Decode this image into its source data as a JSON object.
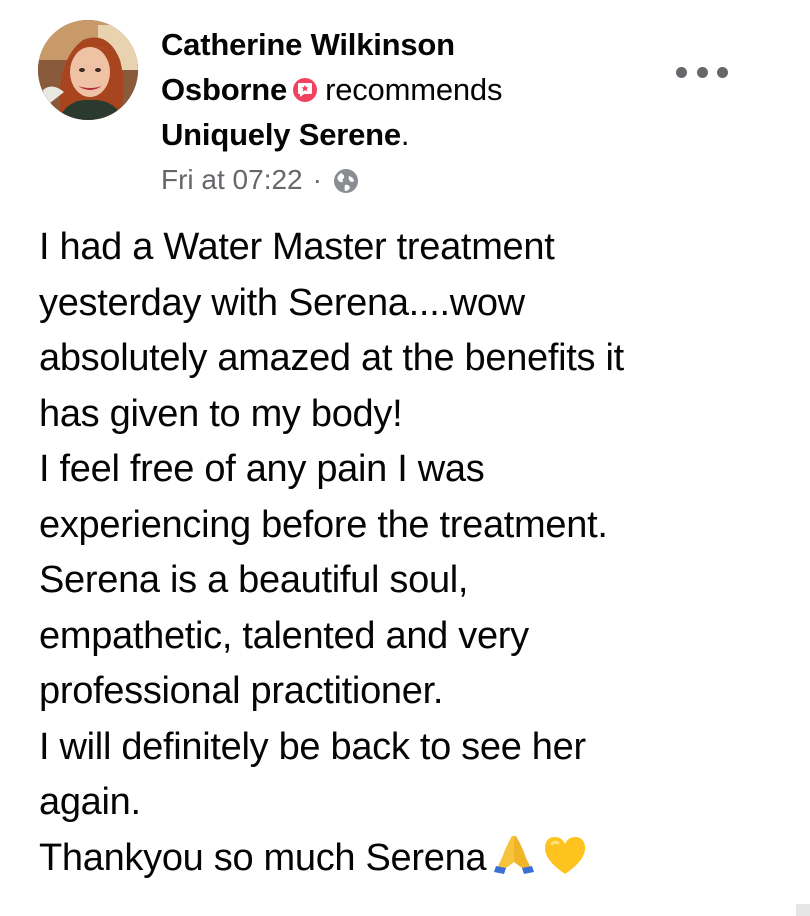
{
  "post": {
    "author": {
      "name_line1": "Catherine Wilkinson",
      "name_line2": "Osborne",
      "avatar_icon": "profile-photo-avatar",
      "badge_icon": "recommendation-star-badge-icon",
      "badge_color": "#f3425f"
    },
    "action": "recommends",
    "page_name": "Uniquely Serene",
    "page_name_suffix": ".",
    "meta": {
      "timestamp": "Fri at 07:22",
      "separator": "·",
      "privacy_icon": "globe-icon"
    },
    "more_button_icon": "more-options-icon",
    "body_lines": [
      "I had a Water Master treatment",
      "yesterday with Serena....wow",
      "absolutely amazed at the benefits it",
      "has given to my body!",
      "I feel free of any pain I was",
      "experiencing before the treatment.",
      "Serena is a beautiful soul,",
      "empathetic, talented and very",
      "professional practitioner.",
      "I will definitely be back to see her",
      "again.",
      "Thankyou so much Serena"
    ],
    "closing_emojis": [
      "folded-hands-emoji",
      "yellow-heart-emoji"
    ]
  },
  "colors": {
    "text_primary": "#050505",
    "text_secondary": "#65676b",
    "background": "#ffffff"
  }
}
